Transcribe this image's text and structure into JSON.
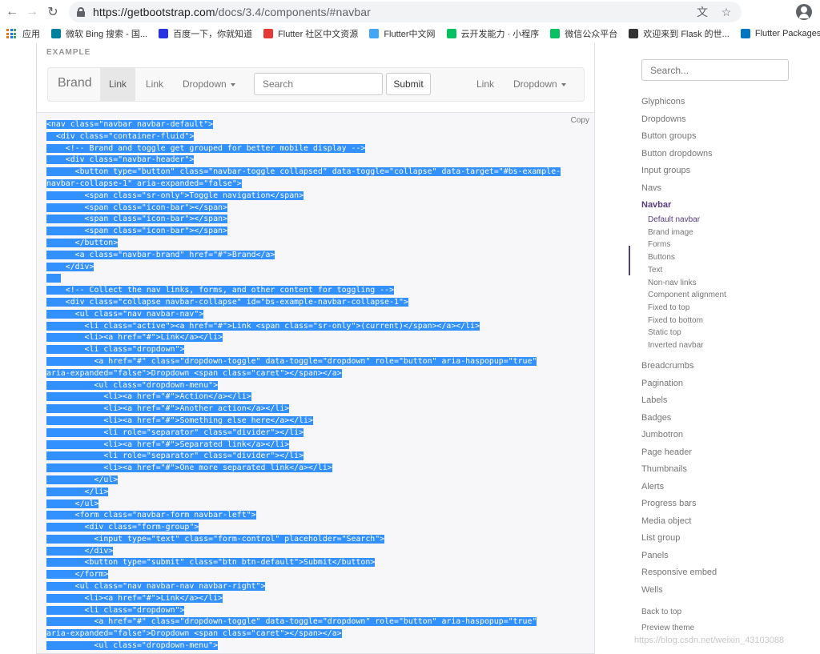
{
  "browser": {
    "url_prefix": "https://getbootstrap.com",
    "url_path": "/docs/3.4/components/#navbar",
    "bookmarks": [
      {
        "label": "应用",
        "color": "#e8710a"
      },
      {
        "label": "微软 Bing 搜索 - 国...",
        "color": "#00809d"
      },
      {
        "label": "百度一下，你就知道",
        "color": "#2932e1"
      },
      {
        "label": "Flutter 社区中文资源",
        "color": "#e53935"
      },
      {
        "label": "Flutter中文网",
        "color": "#42a5f5"
      },
      {
        "label": "云开发能力 · 小程序",
        "color": "#07c160"
      },
      {
        "label": "微信公众平台",
        "color": "#07c160"
      },
      {
        "label": "欢迎来到 Flask 的世...",
        "color": "#333333"
      },
      {
        "label": "Flutter Packages",
        "color": "#0175c2"
      }
    ]
  },
  "example": {
    "label": "EXAMPLE",
    "brand": "Brand",
    "link_active": "Link",
    "link2": "Link",
    "dropdown": "Dropdown",
    "search_placeholder": "Search",
    "submit": "Submit",
    "right_link": "Link",
    "right_dropdown": "Dropdown"
  },
  "code": {
    "copy_label": "Copy",
    "lines": [
      "<nav class=\"navbar navbar-default\">",
      "  <div class=\"container-fluid\">",
      "    <!-- Brand and toggle get grouped for better mobile display -->",
      "    <div class=\"navbar-header\">",
      "      <button type=\"button\" class=\"navbar-toggle collapsed\" data-toggle=\"collapse\" data-target=\"#bs-example-",
      "navbar-collapse-1\" aria-expanded=\"false\">",
      "        <span class=\"sr-only\">Toggle navigation</span>",
      "        <span class=\"icon-bar\"></span>",
      "        <span class=\"icon-bar\"></span>",
      "        <span class=\"icon-bar\"></span>",
      "      </button>",
      "      <a class=\"navbar-brand\" href=\"#\">Brand</a>",
      "    </div>",
      "",
      "    <!-- Collect the nav links, forms, and other content for toggling -->",
      "    <div class=\"collapse navbar-collapse\" id=\"bs-example-navbar-collapse-1\">",
      "      <ul class=\"nav navbar-nav\">",
      "        <li class=\"active\"><a href=\"#\">Link <span class=\"sr-only\">(current)</span></a></li>",
      "        <li><a href=\"#\">Link</a></li>",
      "        <li class=\"dropdown\">",
      "          <a href=\"#\" class=\"dropdown-toggle\" data-toggle=\"dropdown\" role=\"button\" aria-haspopup=\"true\"",
      "aria-expanded=\"false\">Dropdown <span class=\"caret\"></span></a>",
      "          <ul class=\"dropdown-menu\">",
      "            <li><a href=\"#\">Action</a></li>",
      "            <li><a href=\"#\">Another action</a></li>",
      "            <li><a href=\"#\">Something else here</a></li>",
      "            <li role=\"separator\" class=\"divider\"></li>",
      "            <li><a href=\"#\">Separated link</a></li>",
      "            <li role=\"separator\" class=\"divider\"></li>",
      "            <li><a href=\"#\">One more separated link</a></li>",
      "          </ul>",
      "        </li>",
      "      </ul>",
      "      <form class=\"navbar-form navbar-left\">",
      "        <div class=\"form-group\">",
      "          <input type=\"text\" class=\"form-control\" placeholder=\"Search\">",
      "        </div>",
      "        <button type=\"submit\" class=\"btn btn-default\">Submit</button>",
      "      </form>",
      "      <ul class=\"nav navbar-nav navbar-right\">",
      "        <li><a href=\"#\">Link</a></li>",
      "        <li class=\"dropdown\">",
      "          <a href=\"#\" class=\"dropdown-toggle\" data-toggle=\"dropdown\" role=\"button\" aria-haspopup=\"true\"",
      "aria-expanded=\"false\">Dropdown <span class=\"caret\"></span></a>",
      "          <ul class=\"dropdown-menu\">"
    ]
  },
  "sidebar": {
    "search_placeholder": "Search...",
    "items_top": [
      "Glyphicons",
      "Dropdowns",
      "Button groups",
      "Button dropdowns",
      "Input groups",
      "Navs"
    ],
    "active": "Navbar",
    "subitems": [
      "Default navbar",
      "Brand image",
      "Forms",
      "Buttons",
      "Text",
      "Non-nav links",
      "Component alignment",
      "Fixed to top",
      "Fixed to bottom",
      "Static top",
      "Inverted navbar"
    ],
    "items_bottom": [
      "Breadcrumbs",
      "Pagination",
      "Labels",
      "Badges",
      "Jumbotron",
      "Page header",
      "Thumbnails",
      "Alerts",
      "Progress bars",
      "Media object",
      "List group",
      "Panels",
      "Responsive embed",
      "Wells"
    ],
    "back_to_top": "Back to top",
    "preview_theme": "Preview theme"
  },
  "watermark": "https://blog.csdn.net/weixin_43103088"
}
